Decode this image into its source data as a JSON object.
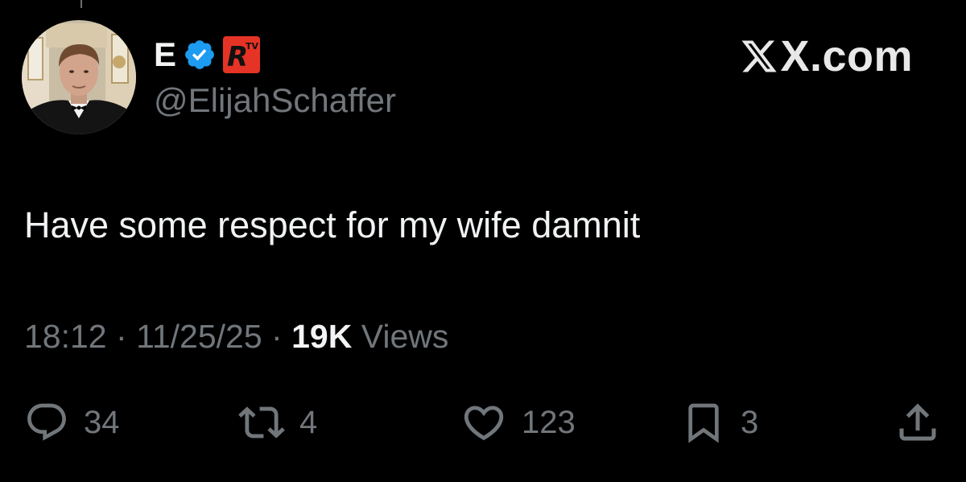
{
  "post": {
    "display_name": "E",
    "handle": "@ElijahSchaffer",
    "brand": "X.com",
    "text": "Have some respect for my wife damnit",
    "time": "18:12",
    "date": "11/25/25",
    "views_count": "19K",
    "views_label": "Views",
    "separator": "·"
  },
  "actions": {
    "reply_count": "34",
    "repost_count": "4",
    "like_count": "123",
    "bookmark_count": "3"
  },
  "icons": {
    "verified": "verified-badge-icon",
    "affiliate": "rtv-logo",
    "brand": "x-logo-icon",
    "reply": "reply-icon",
    "repost": "repost-icon",
    "like": "heart-icon",
    "bookmark": "bookmark-icon",
    "share": "share-icon"
  },
  "colors": {
    "background": "#000000",
    "text": "#e7e9ea",
    "muted": "#71767b",
    "verified": "#1d9bf0",
    "affiliate_red": "#e53326"
  }
}
